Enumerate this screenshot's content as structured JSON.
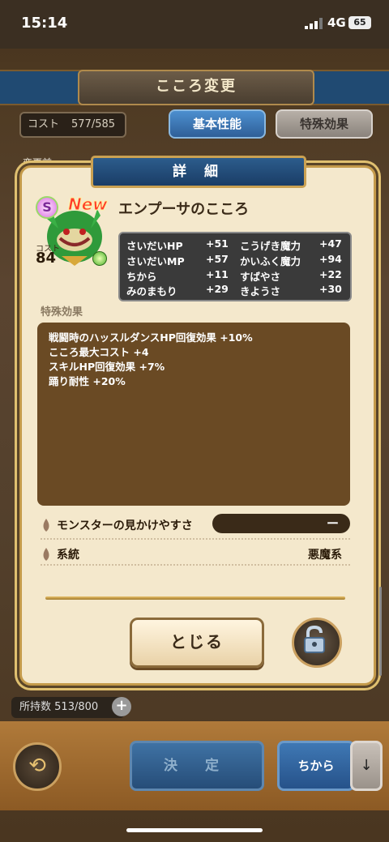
{
  "status": {
    "time": "15:14",
    "network": "4G",
    "battery": "65"
  },
  "header": {
    "title": "こころ変更"
  },
  "cost": {
    "label": "コスト",
    "value": "577/585"
  },
  "tabs": {
    "basic": "基本性能",
    "special": "特殊効果"
  },
  "before_label": "変更前",
  "dialog": {
    "title": "詳 細",
    "monster": {
      "rank": "S",
      "new_badge": "New",
      "name": "エンプーサのこころ",
      "cost_label": "コスト",
      "cost": "84"
    },
    "stats": [
      {
        "label": "さいだいHP",
        "value": "+51"
      },
      {
        "label": "こうげき魔力",
        "value": "+47"
      },
      {
        "label": "さいだいMP",
        "value": "+57"
      },
      {
        "label": "かいふく魔力",
        "value": "+94"
      },
      {
        "label": "ちから",
        "value": "+11"
      },
      {
        "label": "すばやさ",
        "value": "+22"
      },
      {
        "label": "みのまもり",
        "value": "+29"
      },
      {
        "label": "きようさ",
        "value": "+30"
      }
    ],
    "special_label": "特殊効果",
    "effects": [
      "戦闘時のハッスルダンスHP回復効果 +10%",
      "こころ最大コスト +4",
      "スキルHP回復効果 +7%",
      "踊り耐性 +20%"
    ],
    "visibility_label": "モンスターの見かけやすさ",
    "visibility_value": "ー",
    "family_label": "系統",
    "family_value": "悪魔系",
    "close_label": "とじる"
  },
  "owned": {
    "label": "所持数",
    "value": "513/800"
  },
  "bottom": {
    "decide": "決 定",
    "sort": "ちから",
    "sort_arrow": "↓",
    "back": "⟲"
  }
}
